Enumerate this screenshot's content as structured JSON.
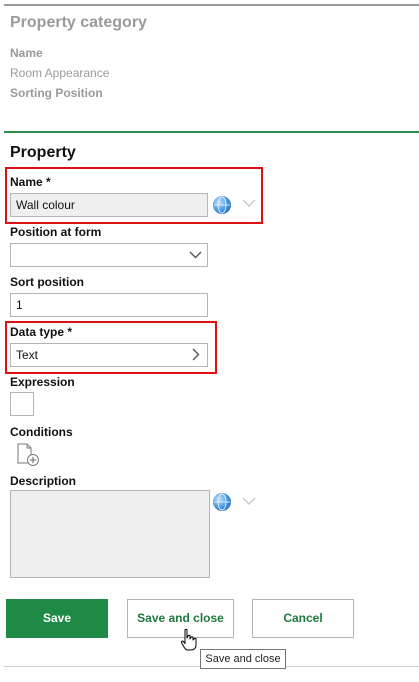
{
  "category": {
    "title": "Property category",
    "name_label": "Name",
    "name_value": "Room Appearance",
    "sorting_label": "Sorting Position"
  },
  "property": {
    "title": "Property",
    "name_label": "Name *",
    "name_value": "Wall colour",
    "position_label": "Position at form",
    "position_value": "",
    "sort_label": "Sort position",
    "sort_value": "1",
    "datatype_label": "Data type *",
    "datatype_value": "Text",
    "expression_label": "Expression",
    "conditions_label": "Conditions",
    "description_label": "Description",
    "description_value": ""
  },
  "buttons": {
    "save": "Save",
    "save_close": "Save and close",
    "cancel": "Cancel"
  },
  "tooltip": "Save and close",
  "icons": {
    "language": "globe-icon",
    "expand": "chevron-down-icon",
    "navigate": "chevron-right-icon",
    "add_condition": "document-add-icon"
  },
  "colors": {
    "accent": "#1f8a45",
    "highlight": "#dd1111"
  }
}
